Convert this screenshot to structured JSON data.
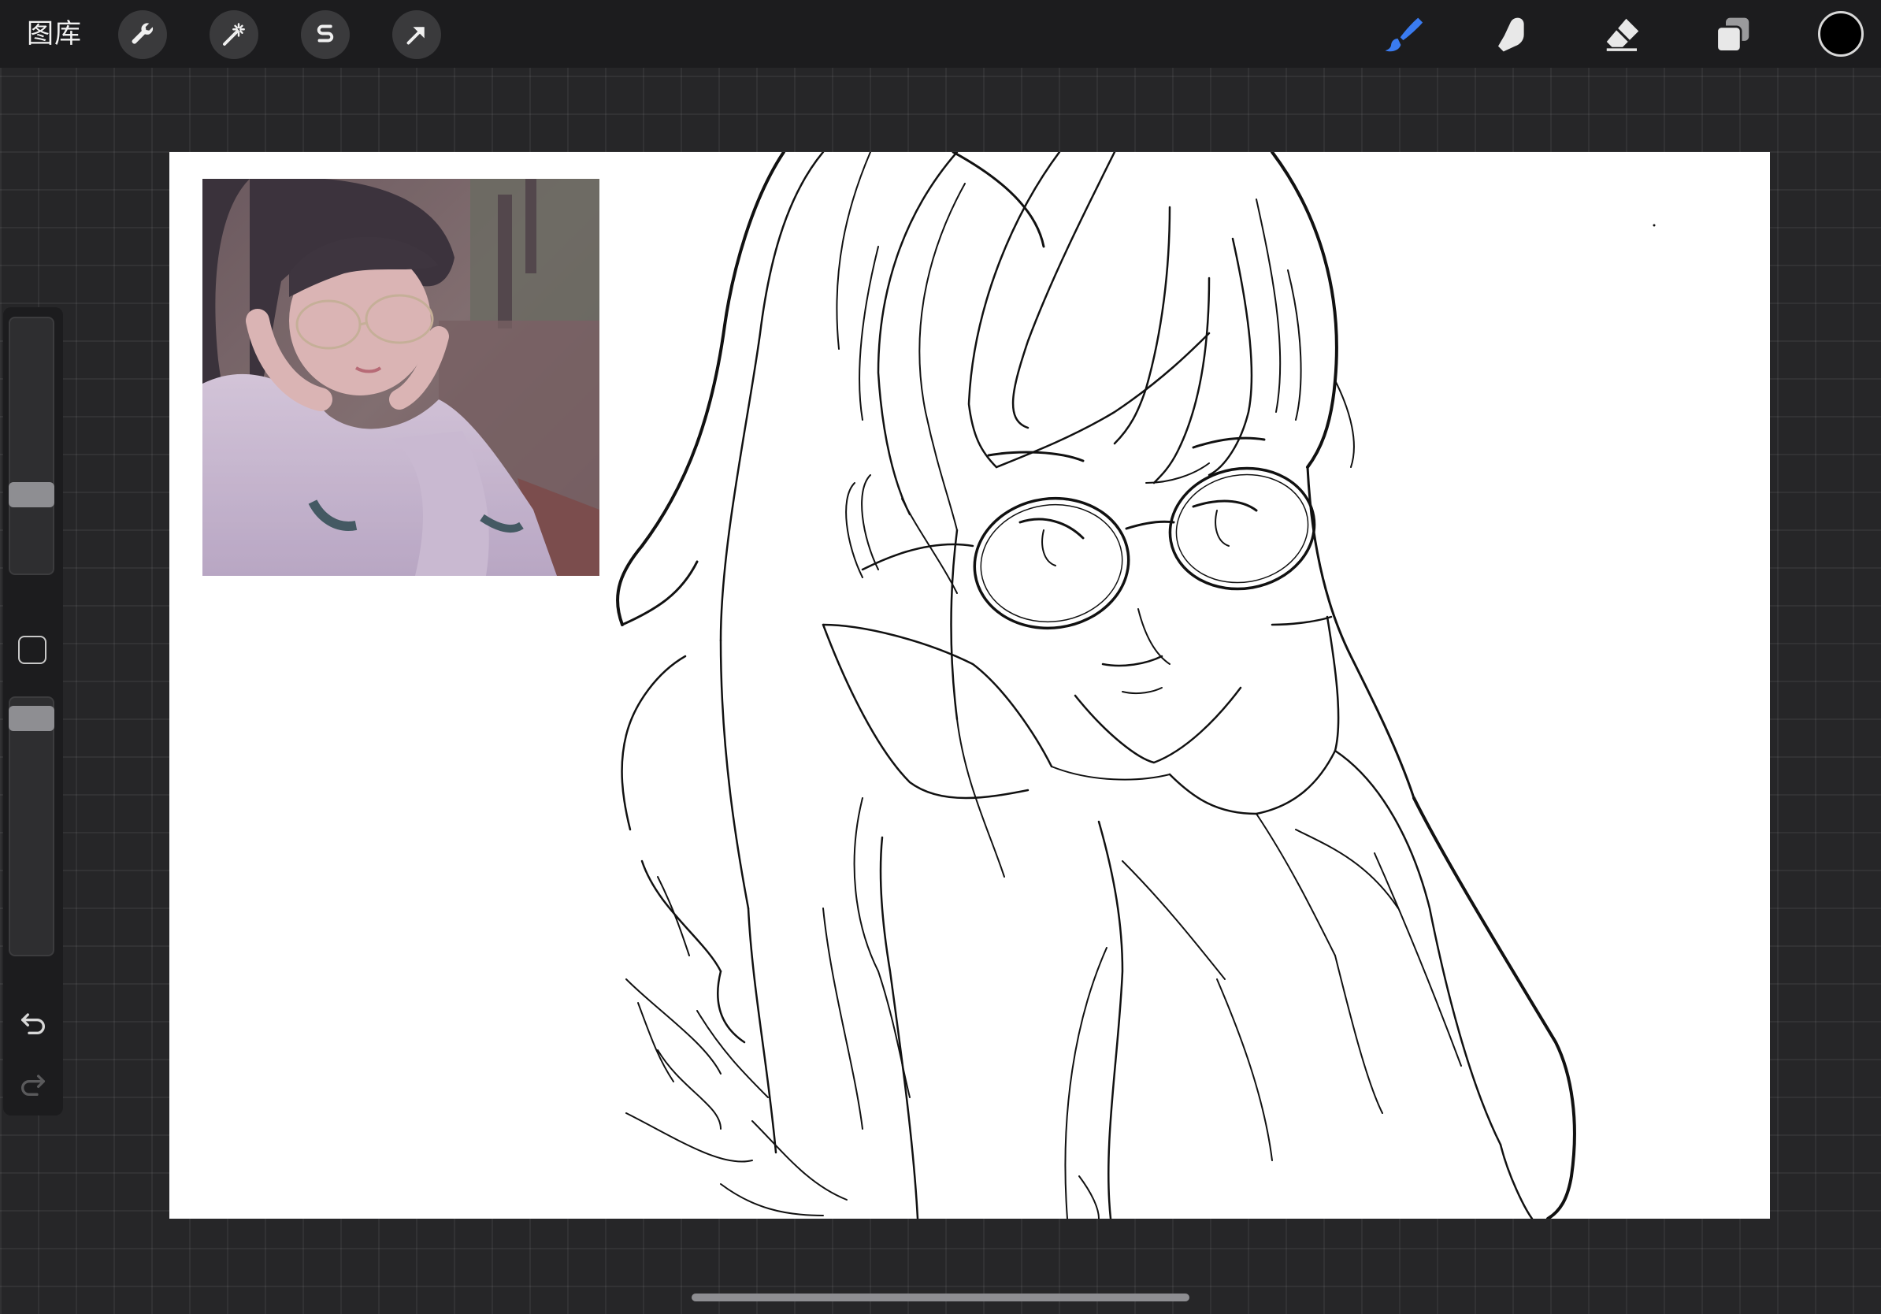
{
  "topbar": {
    "gallery_label": "图库",
    "left_tools": [
      {
        "name": "actions",
        "icon": "wrench-icon"
      },
      {
        "name": "adjustments",
        "icon": "magic-wand-icon"
      },
      {
        "name": "selection",
        "icon": "selection-s-icon"
      },
      {
        "name": "transform",
        "icon": "arrow-cursor-icon"
      }
    ],
    "right_tools": [
      {
        "name": "brush",
        "icon": "paintbrush-icon",
        "active": true
      },
      {
        "name": "smudge",
        "icon": "smudge-finger-icon",
        "active": false
      },
      {
        "name": "eraser",
        "icon": "eraser-icon",
        "active": false
      },
      {
        "name": "layers",
        "icon": "layers-icon",
        "active": false
      }
    ],
    "current_color": "#000000",
    "active_color": "#3a7bf0"
  },
  "sidebar": {
    "brush_size_level": 0.29,
    "opacity_level": 0.96,
    "undo_icon": "undo-arrow-icon",
    "redo_icon": "redo-arrow-icon"
  },
  "canvas": {
    "background": "#ffffff",
    "reference_image": "reference-photo-girl-with-glasses"
  }
}
